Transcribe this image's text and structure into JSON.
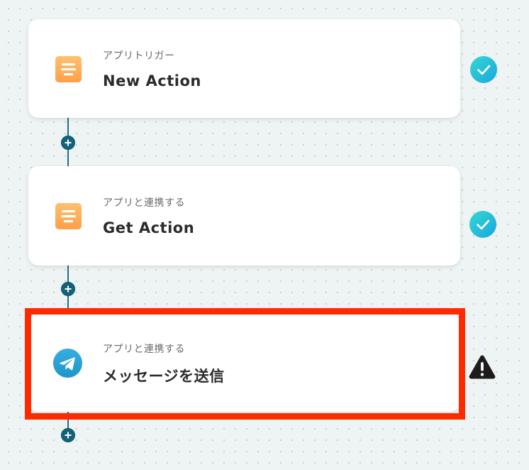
{
  "workflow": {
    "steps": [
      {
        "subtitle": "アプリトリガー",
        "title": "New Action",
        "app_icon": "hubspot-like-app-icon",
        "status": "complete",
        "status_icon": "check-icon"
      },
      {
        "subtitle": "アプリと連携する",
        "title": "Get Action",
        "app_icon": "hubspot-like-app-icon",
        "status": "complete",
        "status_icon": "check-icon"
      },
      {
        "subtitle": "アプリと連携する",
        "title": "メッセージを送信",
        "app_icon": "telegram-icon",
        "status": "warning",
        "status_icon": "warning-icon",
        "highlighted": true
      }
    ],
    "add_step_icon": "plus-icon"
  },
  "colors": {
    "connector": "#1f6f83",
    "add_button": "#12627a",
    "check_gradient_start": "#2fd0d8",
    "check_gradient_end": "#1aa8e0",
    "warning": "#1c1c1c",
    "app_icon_orange": "#ffb15c",
    "telegram_blue": "#2a9fd9",
    "highlight": "#ff2a00"
  }
}
